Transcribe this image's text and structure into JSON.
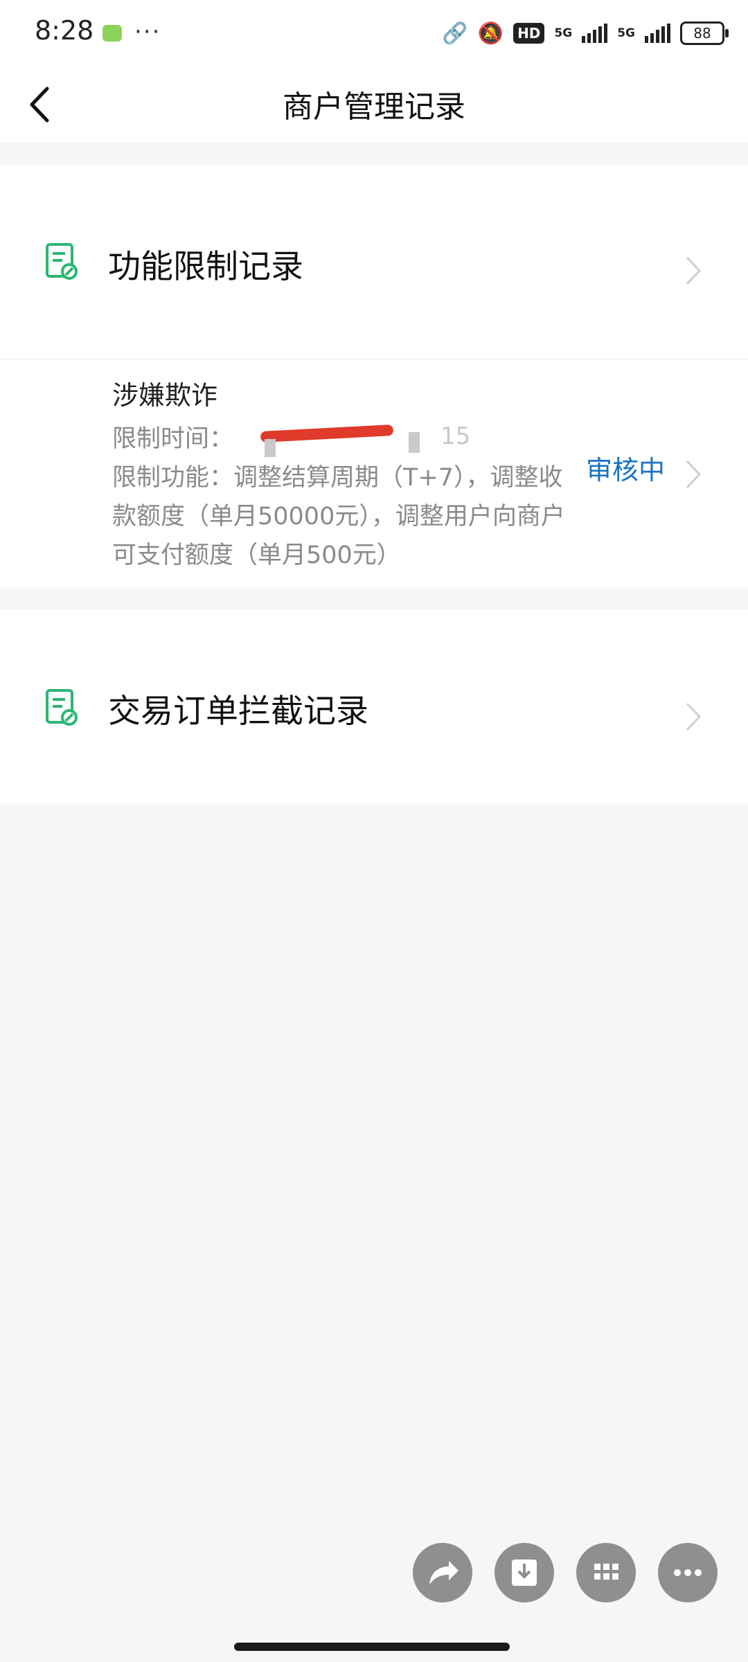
{
  "status_bar": {
    "time": "8:28",
    "more": "···",
    "hd_badge": "HD",
    "net1": "5G",
    "net2": "5G",
    "battery": "88"
  },
  "header": {
    "title": "商户管理记录"
  },
  "sections": {
    "function_limit": {
      "title": "功能限制记录"
    },
    "limit_detail": {
      "reason": "涉嫌欺诈",
      "time_label": "限制时间：",
      "time_tail": "15",
      "functions_label": "限制功能：",
      "functions_text": "调整结算周期（T+7），调整收款额度（单月50000元），调整用户向商户可支付额度（单月500元）",
      "status": "审核中"
    },
    "order_intercept": {
      "title": "交易订单拦截记录"
    }
  },
  "colors": {
    "accent_green": "#2bb673",
    "status_blue": "#1a73c2",
    "redaction_red": "#e03a2a"
  },
  "icons": {
    "back": "chevron-left-icon",
    "record": "document-check-icon",
    "chevron": "chevron-right-icon",
    "share": "share-icon",
    "download": "download-icon",
    "apps": "grid-icon",
    "more": "more-icon"
  }
}
